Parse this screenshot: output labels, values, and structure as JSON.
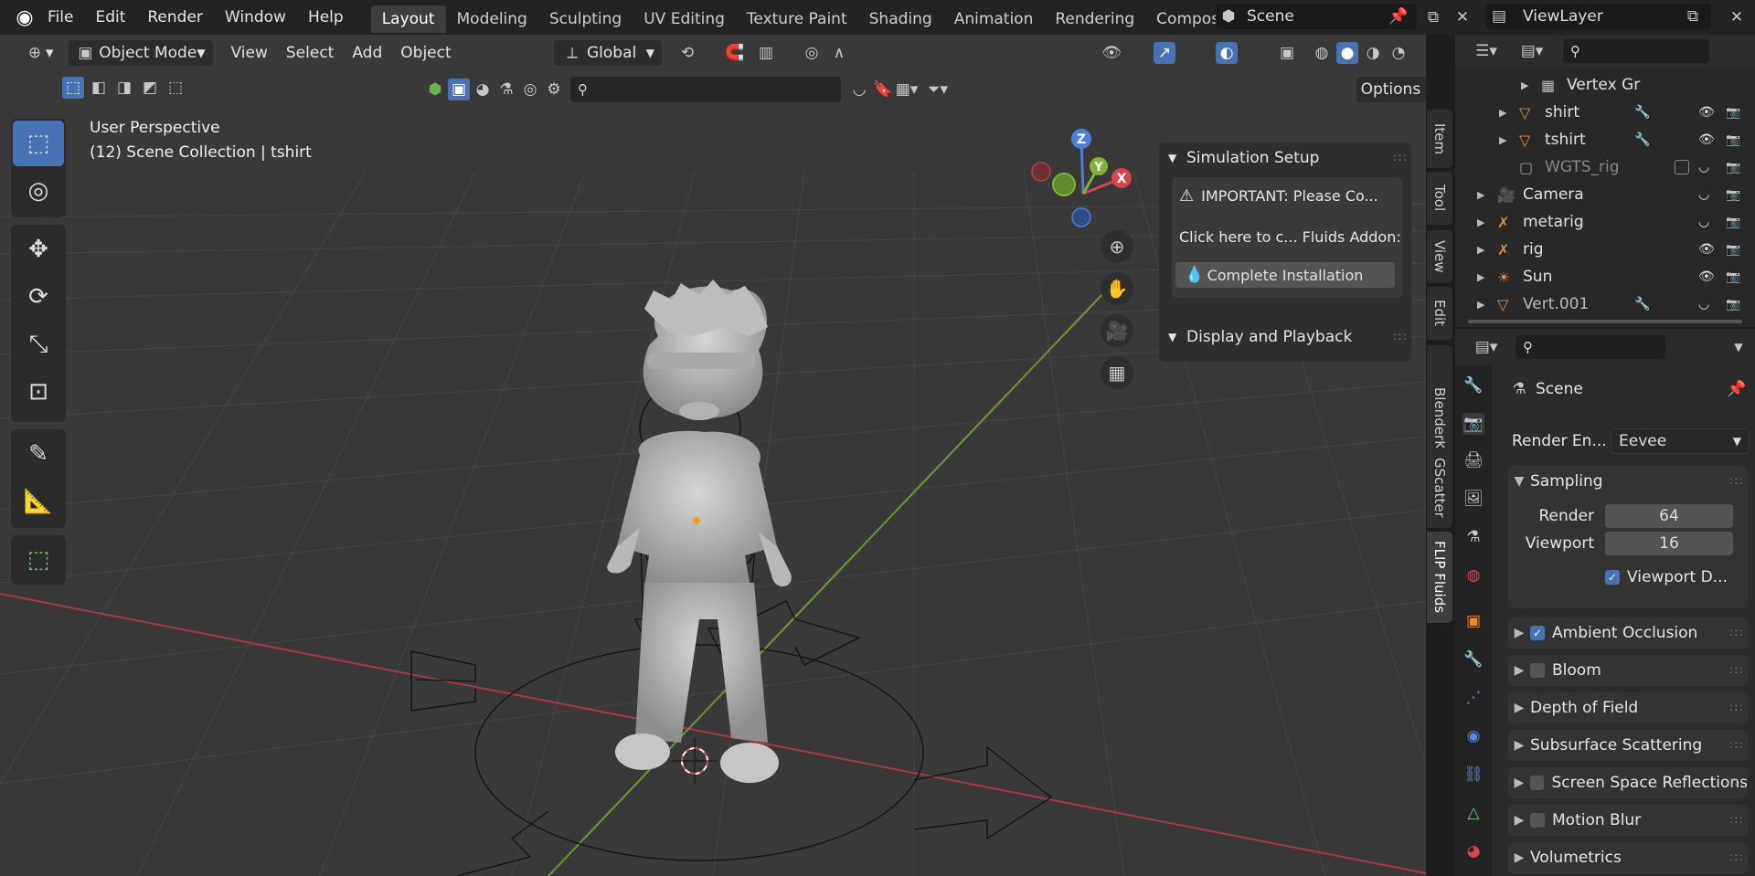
{
  "menu": {
    "file": "File",
    "edit": "Edit",
    "render": "Render",
    "window": "Window",
    "help": "Help"
  },
  "workspaces": [
    "Layout",
    "Modeling",
    "Sculpting",
    "UV Editing",
    "Texture Paint",
    "Shading",
    "Animation",
    "Rendering",
    "Compositing"
  ],
  "scene_name": "Scene",
  "view_layer": "ViewLayer",
  "viewport_header": {
    "mode": "Object Mode",
    "view": "View",
    "select": "Select",
    "add": "Add",
    "object": "Object",
    "orientation": "Global",
    "options": "Options"
  },
  "viewport": {
    "perspective": "User Perspective",
    "collection": "(12) Scene Collection | tshirt"
  },
  "axes": {
    "z": "Z",
    "y": "Y",
    "x": "X"
  },
  "npanel": {
    "section1": "Simulation Setup",
    "warning": "IMPORTANT: Please Co...",
    "click_text": "Click here to c... Fluids Addon:",
    "install_button": "Complete Installation",
    "section2": "Display and Playback"
  },
  "ntabs": [
    "Item",
    "Tool",
    "View",
    "Edit",
    "BlenderKit",
    "GScatter",
    "FLIP Fluids"
  ],
  "outliner": [
    {
      "name": "Vertex Gr",
      "indent": 3,
      "icon": "vertex-group-icon"
    },
    {
      "name": "shirt",
      "indent": 2,
      "icon": "mesh-icon"
    },
    {
      "name": "tshirt",
      "indent": 2,
      "icon": "mesh-icon"
    },
    {
      "name": "WGTS_rig",
      "indent": 2,
      "icon": "collection-icon"
    },
    {
      "name": "Camera",
      "indent": 1,
      "icon": "camera-icon"
    },
    {
      "name": "metarig",
      "indent": 1,
      "icon": "armature-icon"
    },
    {
      "name": "rig",
      "indent": 1,
      "icon": "armature-icon"
    },
    {
      "name": "Sun",
      "indent": 1,
      "icon": "light-icon"
    },
    {
      "name": "Vert.001",
      "indent": 1,
      "icon": "mesh-icon"
    }
  ],
  "properties": {
    "scene": "Scene",
    "render_engine_label": "Render En...",
    "render_engine": "Eevee",
    "sampling": "Sampling",
    "render_label": "Render",
    "render_value": "64",
    "viewport_label": "Viewport",
    "viewport_value": "16",
    "viewport_denoise": "Viewport D...",
    "sections": [
      {
        "label": "Ambient Occlusion",
        "checkbox": true,
        "checked": true
      },
      {
        "label": "Bloom",
        "checkbox": true,
        "checked": false
      },
      {
        "label": "Depth of Field",
        "checkbox": false,
        "checked": false
      },
      {
        "label": "Subsurface Scattering",
        "checkbox": false,
        "checked": false
      },
      {
        "label": "Screen Space Reflections",
        "checkbox": true,
        "checked": false
      },
      {
        "label": "Motion Blur",
        "checkbox": true,
        "checked": false
      },
      {
        "label": "Volumetrics",
        "checkbox": false,
        "checked": false
      }
    ]
  },
  "colors": {
    "accent": "#4772b3",
    "x_axis": "#d6454f",
    "y_axis": "#7fb33a",
    "z_axis": "#4f7fd6"
  }
}
